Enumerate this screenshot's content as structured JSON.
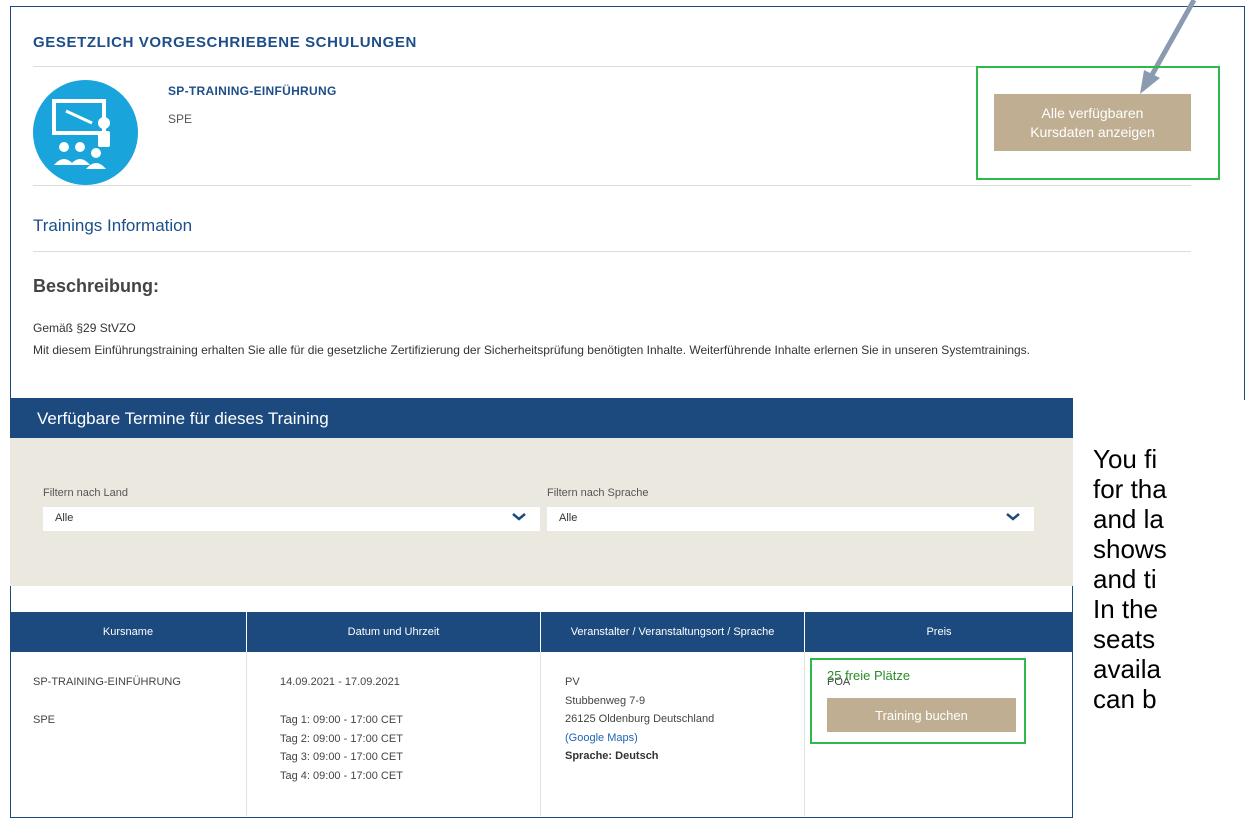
{
  "header": {
    "section_title": "GESETZLICH VORGESCHRIEBENE SCHULUNGEN"
  },
  "course": {
    "name": "SP-TRAINING-EINFÜHRUNG",
    "code": "SPE",
    "icon": "classroom-training-icon"
  },
  "actions": {
    "show_dates_line1": "Alle verfügbaren",
    "show_dates_line2": "Kursdaten anzeigen"
  },
  "info": {
    "title": "Trainings Information",
    "description_heading": "Beschreibung:",
    "description_line1": "Gemäß §29 StVZO",
    "description_line2": "Mit diesem Einführungstraining erhalten Sie alle für die gesetzliche Zertifizierung der Sicherheitsprüfung benötigten Inhalte. Weiterführende Inhalte erlernen Sie in unseren Systemtrainings."
  },
  "dates_panel": {
    "title": "Verfügbare Termine für dieses Training",
    "filter_country_label": "Filtern nach Land",
    "filter_country_value": "Alle",
    "filter_language_label": "Filtern nach Sprache",
    "filter_language_value": "Alle"
  },
  "table": {
    "headers": [
      "Kursname",
      "Datum und Uhrzeit",
      "Veranstalter / Veranstaltungsort / Sprache",
      "Preis"
    ],
    "row": {
      "course_name": "SP-TRAINING-EINFÜHRUNG",
      "course_code": "SPE",
      "date_range": "14.09.2021 - 17.09.2021",
      "days": [
        "Tag 1: 09:00 - 17:00 CET",
        "Tag 2: 09:00 - 17:00 CET",
        "Tag 3: 09:00 - 17:00 CET",
        "Tag 4: 09:00 - 17:00 CET"
      ],
      "organizer": "PV",
      "street": "Stubbenweg 7-9",
      "city": "26125 Oldenburg Deutschland",
      "maps_link": "(Google Maps)",
      "language": "Sprache: Deutsch",
      "price": "POA",
      "seats": "25  freie Plätze",
      "book_label": "Training buchen"
    }
  },
  "annotation": {
    "lines": [
      "You fi",
      "for tha",
      "and la",
      "shows",
      "and ti",
      "In the",
      "seats",
      "availa",
      "can b"
    ]
  },
  "colors": {
    "primary_blue": "#1c4a7e",
    "accent_tan": "#bfae91",
    "highlight_green": "#2fb84b",
    "icon_blue": "#1aa4dc",
    "filter_bg": "#ebe8df"
  }
}
